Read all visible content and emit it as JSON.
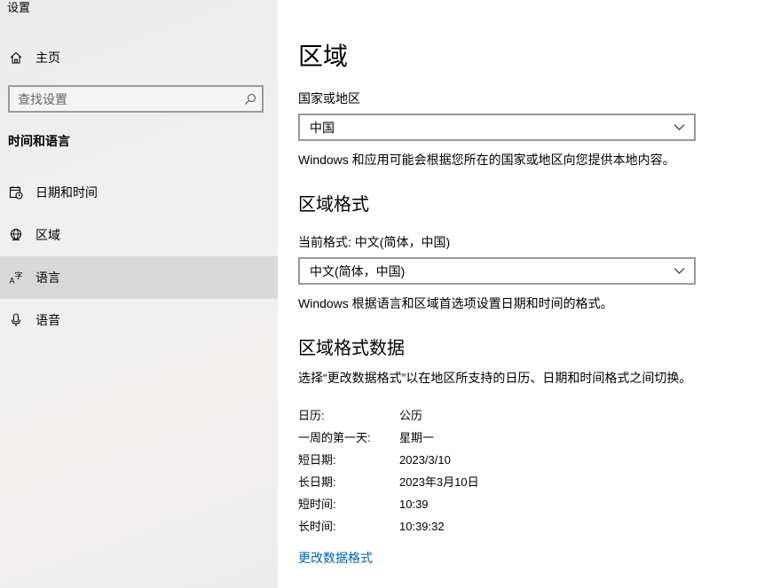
{
  "app": {
    "title": "设置"
  },
  "sidebar": {
    "home_label": "主页",
    "search_placeholder": "查找设置",
    "section_header": "时间和语言",
    "items": [
      {
        "label": "日期和时间",
        "icon": "calendar-clock-icon"
      },
      {
        "label": "区域",
        "icon": "globe-icon"
      },
      {
        "label": "语言",
        "icon": "language-icon",
        "selected": true
      },
      {
        "label": "语音",
        "icon": "microphone-icon"
      }
    ]
  },
  "main": {
    "title": "区域",
    "country_label": "国家或地区",
    "country_value": "中国",
    "country_desc": "Windows 和应用可能会根据您所在的国家或地区向您提供本地内容。",
    "format_title": "区域格式",
    "format_current_label": "当前格式: 中文(简体，中国)",
    "format_value": "中文(简体，中国)",
    "format_desc": "Windows 根据语言和区域首选项设置日期和时间的格式。",
    "data_title": "区域格式数据",
    "data_desc": "选择“更改数据格式”以在地区所支持的日历、日期和时间格式之间切换。",
    "rows": [
      {
        "label": "日历:",
        "value": "公历"
      },
      {
        "label": "一周的第一天:",
        "value": "星期一"
      },
      {
        "label": "短日期:",
        "value": "2023/3/10"
      },
      {
        "label": "长日期:",
        "value": "2023年3月10日"
      },
      {
        "label": "短时间:",
        "value": "10:39"
      },
      {
        "label": "长时间:",
        "value": "10:39:32"
      }
    ],
    "change_link": "更改数据格式"
  },
  "colors": {
    "link": "#0063b1",
    "selected_bg": "#d9d9d9",
    "border": "#999999"
  }
}
